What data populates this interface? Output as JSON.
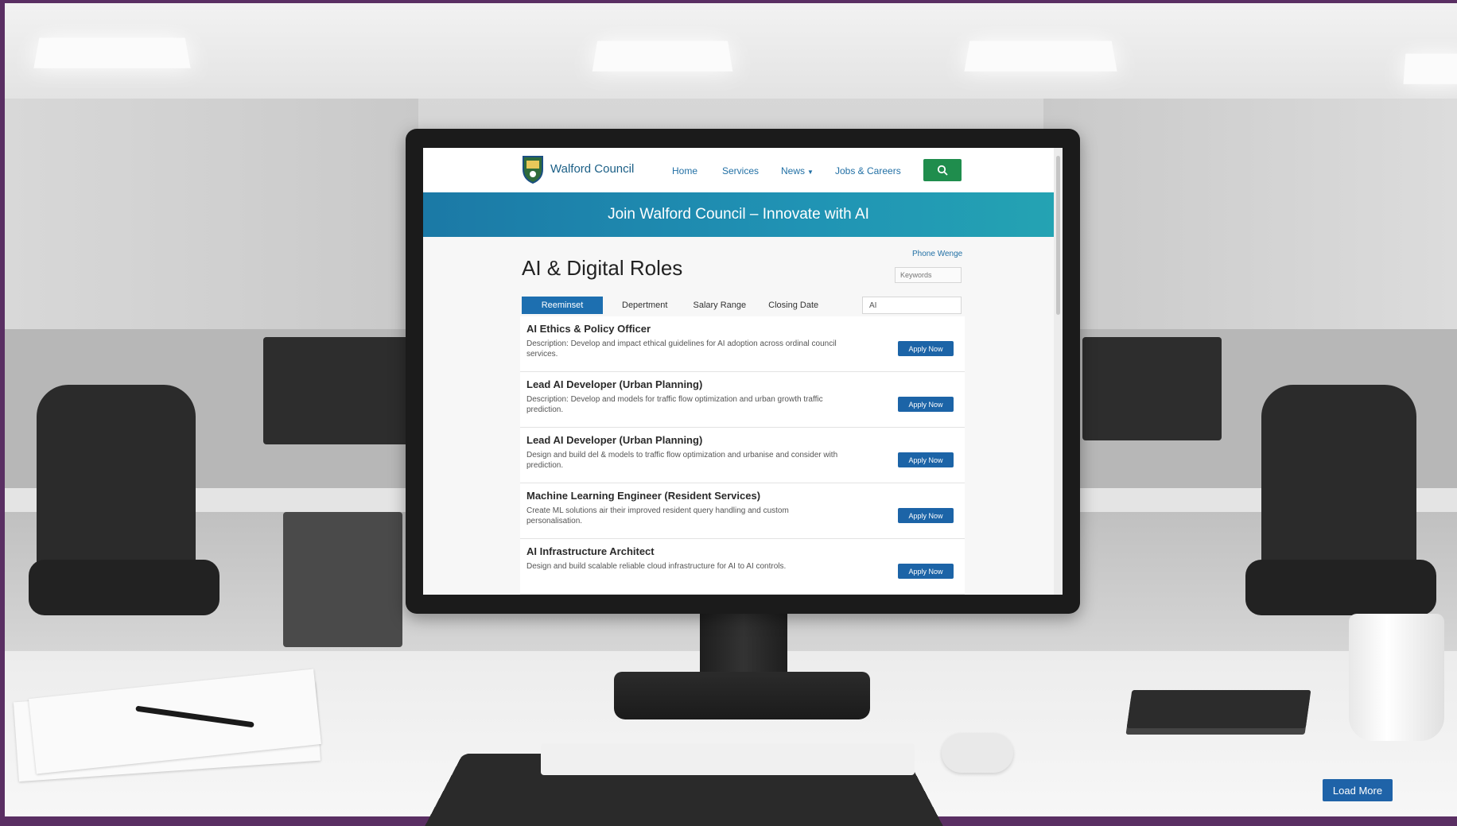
{
  "header": {
    "brand": "Walford Council",
    "nav": [
      "Home",
      "Services",
      "News",
      "Jobs & Careers"
    ]
  },
  "banner": {
    "title": "Join Walford Council – Innovate with AI"
  },
  "main": {
    "title": "AI & Digital Roles",
    "filter_link": "Phone Wenge",
    "keyword_placeholder": "Keywords",
    "tabs": [
      "Reeminset",
      "Depertment",
      "Salary Range",
      "Closing Date"
    ],
    "tab_input_value": "AI",
    "roles": [
      {
        "title": "AI Ethics & Policy Officer",
        "desc": "Description: Develop and impact ethical guidelines for AI adoption across ordinal council services.",
        "apply": "Apply Now"
      },
      {
        "title": "Lead AI Developer (Urban Planning)",
        "desc": "Description: Develop and models for traffic flow optimization and urban growth traffic prediction.",
        "apply": "Apply Now"
      },
      {
        "title": "Lead AI Developer (Urban Planning)",
        "desc": "Design and build del & models to traffic flow optimization and urbanise and consider with prediction.",
        "apply": "Apply Now"
      },
      {
        "title": "Machine Learning Engineer (Resident Services)",
        "desc": "Create ML solutions air their improved resident query handling and custom personalisation.",
        "apply": "Apply Now"
      },
      {
        "title": "AI Infrastructure Architect",
        "desc": "Design and build scalable reliable cloud infrastructure for AI to AI controls.",
        "apply": "Apply Now"
      }
    ]
  },
  "footer": {
    "load_more": "Load More"
  },
  "colors": {
    "banner": "#1b79a6",
    "primary": "#1c64a7",
    "search": "#1f8d4d"
  }
}
